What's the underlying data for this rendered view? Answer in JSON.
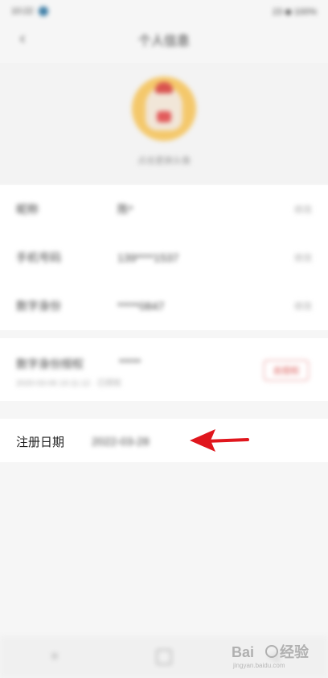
{
  "status_bar": {
    "time": "10:22",
    "right_text": "23 ◆ 100%"
  },
  "nav": {
    "back_icon": "‹",
    "title": "个人信息"
  },
  "profile": {
    "avatar_caption": "点击更换头像"
  },
  "info_rows": [
    {
      "label": "昵称",
      "value": "陈*",
      "action": "修改"
    },
    {
      "label": "手机号码",
      "value": "139****1537",
      "action": "修改"
    },
    {
      "label": "数字身份",
      "value": "*****0847",
      "action": "修改"
    }
  ],
  "binding": {
    "label": "数字身份授权",
    "sub": "2020-03-06 10:11:12 · 已授权",
    "value": "*****",
    "button": "去授权"
  },
  "registration": {
    "label": "注册日期",
    "value": "2022-03-28"
  },
  "annotation": {
    "arrow_color": "#e0161d"
  },
  "watermark": {
    "brand": "Bai",
    "brand_suffix": "经验",
    "url": "jingyan.baidu.com"
  }
}
